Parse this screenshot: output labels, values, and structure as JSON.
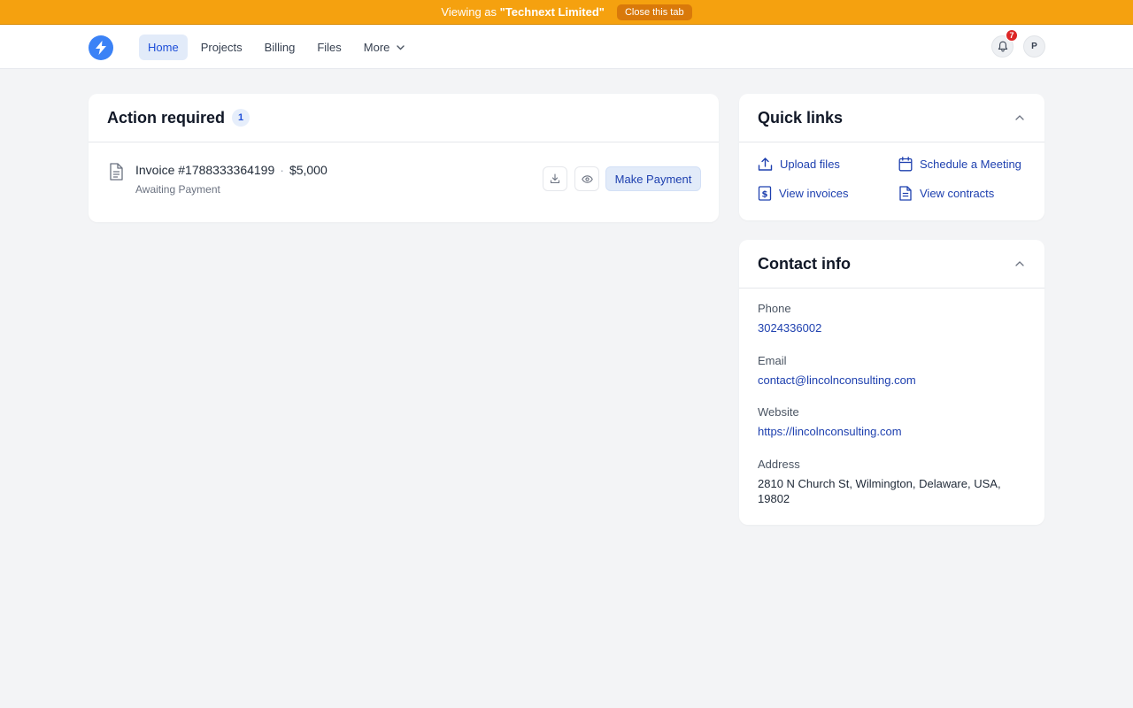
{
  "banner": {
    "prefix": "Viewing as",
    "account": "\"Technext Limited\"",
    "close_label": "Close this tab"
  },
  "nav": {
    "items": [
      {
        "label": "Home",
        "active": true
      },
      {
        "label": "Projects"
      },
      {
        "label": "Billing"
      },
      {
        "label": "Files"
      },
      {
        "label": "More"
      }
    ],
    "notifications_count": "7",
    "avatar_initial": "P"
  },
  "action_required": {
    "title": "Action required",
    "count": "1",
    "invoice": {
      "number": "Invoice #1788333364199",
      "separator": "·",
      "amount": "$5,000",
      "status": "Awaiting Payment",
      "pay_label": "Make Payment"
    }
  },
  "quick_links": {
    "title": "Quick links",
    "items": [
      {
        "label": "Upload files",
        "icon": "upload-icon"
      },
      {
        "label": "Schedule a Meeting",
        "icon": "calendar-icon"
      },
      {
        "label": "View invoices",
        "icon": "invoice-icon"
      },
      {
        "label": "View contracts",
        "icon": "contract-icon"
      }
    ]
  },
  "contact": {
    "title": "Contact info",
    "phone_label": "Phone",
    "phone": "3024336002",
    "email_label": "Email",
    "email": "contact@lincolnconsulting.com",
    "website_label": "Website",
    "website": "https://lincolnconsulting.com",
    "address_label": "Address",
    "address": "2810 N Church St, Wilmington, Delaware, USA, 19802"
  },
  "colors": {
    "banner": "#f5a10f",
    "accent": "#1d4ed8",
    "badge": "#dc2626"
  }
}
